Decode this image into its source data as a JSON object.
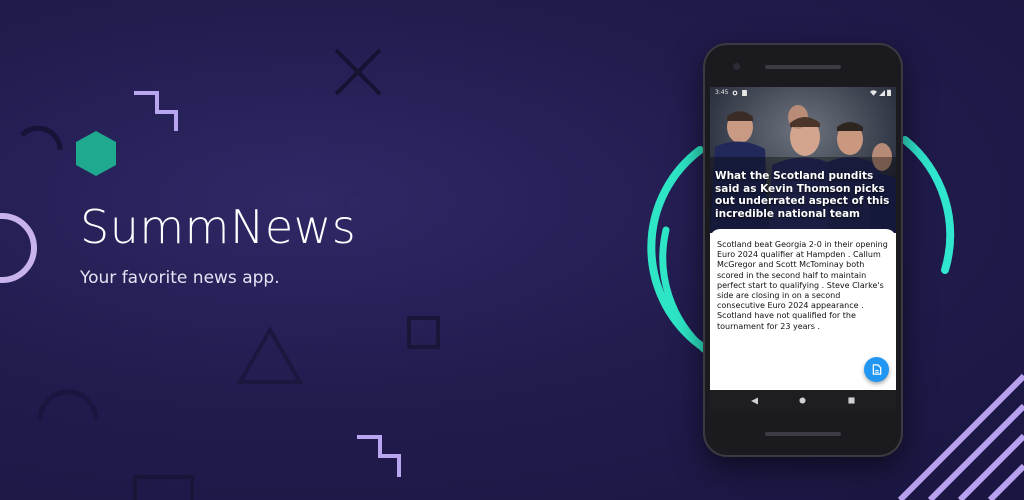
{
  "brand": {
    "title": "SummNews",
    "tagline": "Your favorite news app."
  },
  "colors": {
    "background": "#221c4f",
    "accent_teal": "#2ee6c6",
    "accent_lavender": "#b9a6f0",
    "fab_blue": "#2196f3"
  },
  "phone": {
    "status_bar": {
      "time": "3:45",
      "left_icons": [
        "settings-icon",
        "sim-icon"
      ],
      "right_icons": [
        "wifi-icon",
        "signal-icon",
        "battery-icon"
      ]
    },
    "article": {
      "hero_image": "scotland-players-celebrating",
      "headline": "What the Scotland pundits said as Kevin Thomson picks out underrated aspect of this incredible national team",
      "summary": " Scotland beat Georgia 2-0 in their opening Euro 2024 qualifier at Hampden . Callum McGregor and Scott McTominay both scored in the second half to maintain perfect start to qualifying . Steve Clarke's side are closing in on a second consecutive Euro 2024 appearance . Scotland have not qualified for the tournament for 23 years ."
    },
    "fab_icon": "document-icon",
    "nav": [
      "back-icon",
      "home-icon",
      "recents-icon"
    ]
  }
}
